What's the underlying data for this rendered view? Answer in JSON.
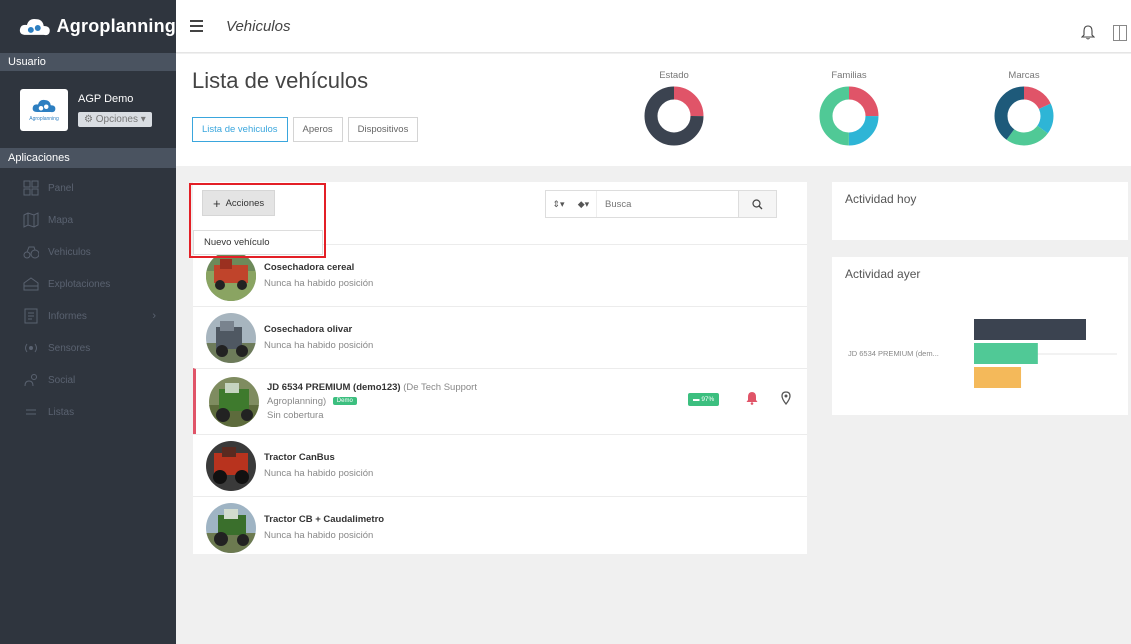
{
  "brand": {
    "name": "Agroplanning"
  },
  "sidebar": {
    "user_section_label": "Usuario",
    "user_name": "AGP Demo",
    "user_avatar_caption": "Agroplanning",
    "options_label": "Opciones",
    "apps_section_label": "Aplicaciones",
    "items": [
      {
        "label": "Panel",
        "icon": "grid-icon"
      },
      {
        "label": "Mapa",
        "icon": "map-icon"
      },
      {
        "label": "Vehiculos",
        "icon": "vehicle-icon"
      },
      {
        "label": "Explotaciones",
        "icon": "farm-icon"
      },
      {
        "label": "Informes",
        "icon": "report-icon"
      },
      {
        "label": "Sensores",
        "icon": "sensor-icon"
      },
      {
        "label": "Social",
        "icon": "social-icon"
      },
      {
        "label": "Listas",
        "icon": "list-icon"
      }
    ]
  },
  "topbar": {
    "title": "Vehiculos"
  },
  "header": {
    "page_title": "Lista de vehículos",
    "tabs": [
      {
        "label": "Lista de vehiculos",
        "active": true
      },
      {
        "label": "Aperos",
        "active": false
      },
      {
        "label": "Dispositivos",
        "active": false
      }
    ],
    "donuts": [
      {
        "label": "Estado"
      },
      {
        "label": "Familias"
      },
      {
        "label": "Marcas"
      }
    ]
  },
  "list": {
    "actions_label": "Acciones",
    "dropdown_item": "Nuevo vehículo",
    "search_placeholder": "Busca",
    "vehicles": [
      {
        "name": "Cosechadora cereal",
        "status": "Nunca ha habido posición"
      },
      {
        "name": "Cosechadora olivar",
        "status": "Nunca ha habido posición"
      },
      {
        "name": "JD 6534 PREMIUM (demo123)",
        "extra": "(De Tech Support",
        "extra2": "Agroplanning)",
        "badge": "Demo",
        "status": "Sin cobertura",
        "battery": "97%"
      },
      {
        "name": "Tractor CanBus",
        "status": "Nunca ha habido posición"
      },
      {
        "name": "Tractor CB + Caudalimetro",
        "status": "Nunca ha habido posición"
      }
    ]
  },
  "activity": {
    "today_title": "Actividad hoy",
    "yesterday_title": "Actividad ayer",
    "bar_label": "JD 6534 PREMIUM (dem..."
  },
  "chart_data": [
    {
      "type": "pie",
      "title": "Estado",
      "colors": [
        "#e05468",
        "#3b4350"
      ],
      "values": [
        25,
        75
      ]
    },
    {
      "type": "pie",
      "title": "Familias",
      "colors": [
        "#e05468",
        "#2eb5d6",
        "#50c996"
      ],
      "values": [
        25,
        25,
        50
      ]
    },
    {
      "type": "pie",
      "title": "Marcas",
      "colors": [
        "#e05468",
        "#2eb5d6",
        "#50c996",
        "#1e5a7a"
      ],
      "values": [
        18,
        17,
        25,
        40
      ]
    },
    {
      "type": "bar",
      "title": "Actividad ayer",
      "categories": [
        "JD 6534 PREMIUM (dem..."
      ],
      "series": [
        {
          "values": [
            100
          ],
          "color": "#3b4350"
        },
        {
          "values": [
            57
          ],
          "color": "#50c996"
        },
        {
          "values": [
            42
          ],
          "color": "#f4b95a"
        }
      ]
    }
  ]
}
